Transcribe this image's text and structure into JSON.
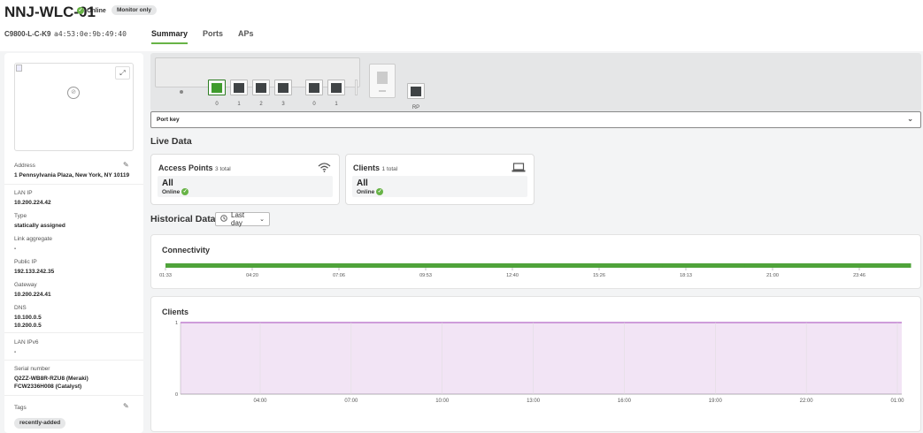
{
  "header": {
    "device_name": "NNJ-WLC-01",
    "status": "Online",
    "monitor_badge": "Monitor only",
    "model": "C9800-L-C-K9",
    "mac": "a4:53:0e:9b:49:40"
  },
  "tabs": [
    {
      "label": "Summary",
      "active": true
    },
    {
      "label": "Ports",
      "active": false
    },
    {
      "label": "APs",
      "active": false
    }
  ],
  "sidebar": {
    "address_label": "Address",
    "address_value": "1 Pennsylvania Plaza, New York, NY 10119",
    "lan_ip_label": "LAN IP",
    "lan_ip_value": "10.200.224.42",
    "type_label": "Type",
    "type_value": "statically assigned",
    "link_agg_label": "Link aggregate",
    "link_agg_value": "-",
    "public_ip_label": "Public IP",
    "public_ip_value": "192.133.242.35",
    "gateway_label": "Gateway",
    "gateway_value": "10.200.224.41",
    "dns_label": "DNS",
    "dns_value_1": "10.100.0.5",
    "dns_value_2": "10.200.0.5",
    "lan_ipv6_label": "LAN IPv6",
    "lan_ipv6_value": "-",
    "serial_label": "Serial number",
    "serial_value_1": "Q2ZZ-WB8R-RZU8 (Meraki)",
    "serial_value_2": "FCW2336H008 (Catalyst)",
    "tags_label": "Tags",
    "tag_1": "recently-added"
  },
  "ports": {
    "labels": [
      "0",
      "1",
      "2",
      "3",
      "0",
      "1"
    ],
    "statuses": [
      "up",
      "down",
      "down",
      "down",
      "down",
      "down"
    ],
    "rp_label": "RP",
    "port_key": "Port key"
  },
  "live": {
    "title": "Live Data",
    "ap_title": "Access Points",
    "ap_count": "3 total",
    "ap_all": "All",
    "ap_online": "Online",
    "clients_title": "Clients",
    "clients_count": "1 total",
    "clients_all": "All",
    "clients_online": "Online"
  },
  "historical": {
    "title": "Historical Data",
    "range": "Last day"
  },
  "chart_data": [
    {
      "type": "area",
      "title": "Connectivity",
      "x": [
        "01:33",
        "04:20",
        "07:06",
        "09:53",
        "12:40",
        "15:26",
        "18:13",
        "21:00",
        "23:46"
      ],
      "series": [
        {
          "values": [
            1,
            1,
            1,
            1,
            1,
            1,
            1,
            1,
            1
          ]
        }
      ],
      "colors": [
        "#4fa33a"
      ]
    },
    {
      "type": "area",
      "title": "Clients",
      "x": [
        "04:00",
        "07:00",
        "10:00",
        "13:00",
        "16:00",
        "19:00",
        "22:00",
        "01:00"
      ],
      "ylim": [
        0,
        1
      ],
      "yticks": [
        0,
        1
      ],
      "series": [
        {
          "values": [
            1,
            1,
            1,
            1,
            1,
            1,
            1,
            1
          ]
        }
      ],
      "colors": [
        "#b569c8"
      ]
    }
  ]
}
